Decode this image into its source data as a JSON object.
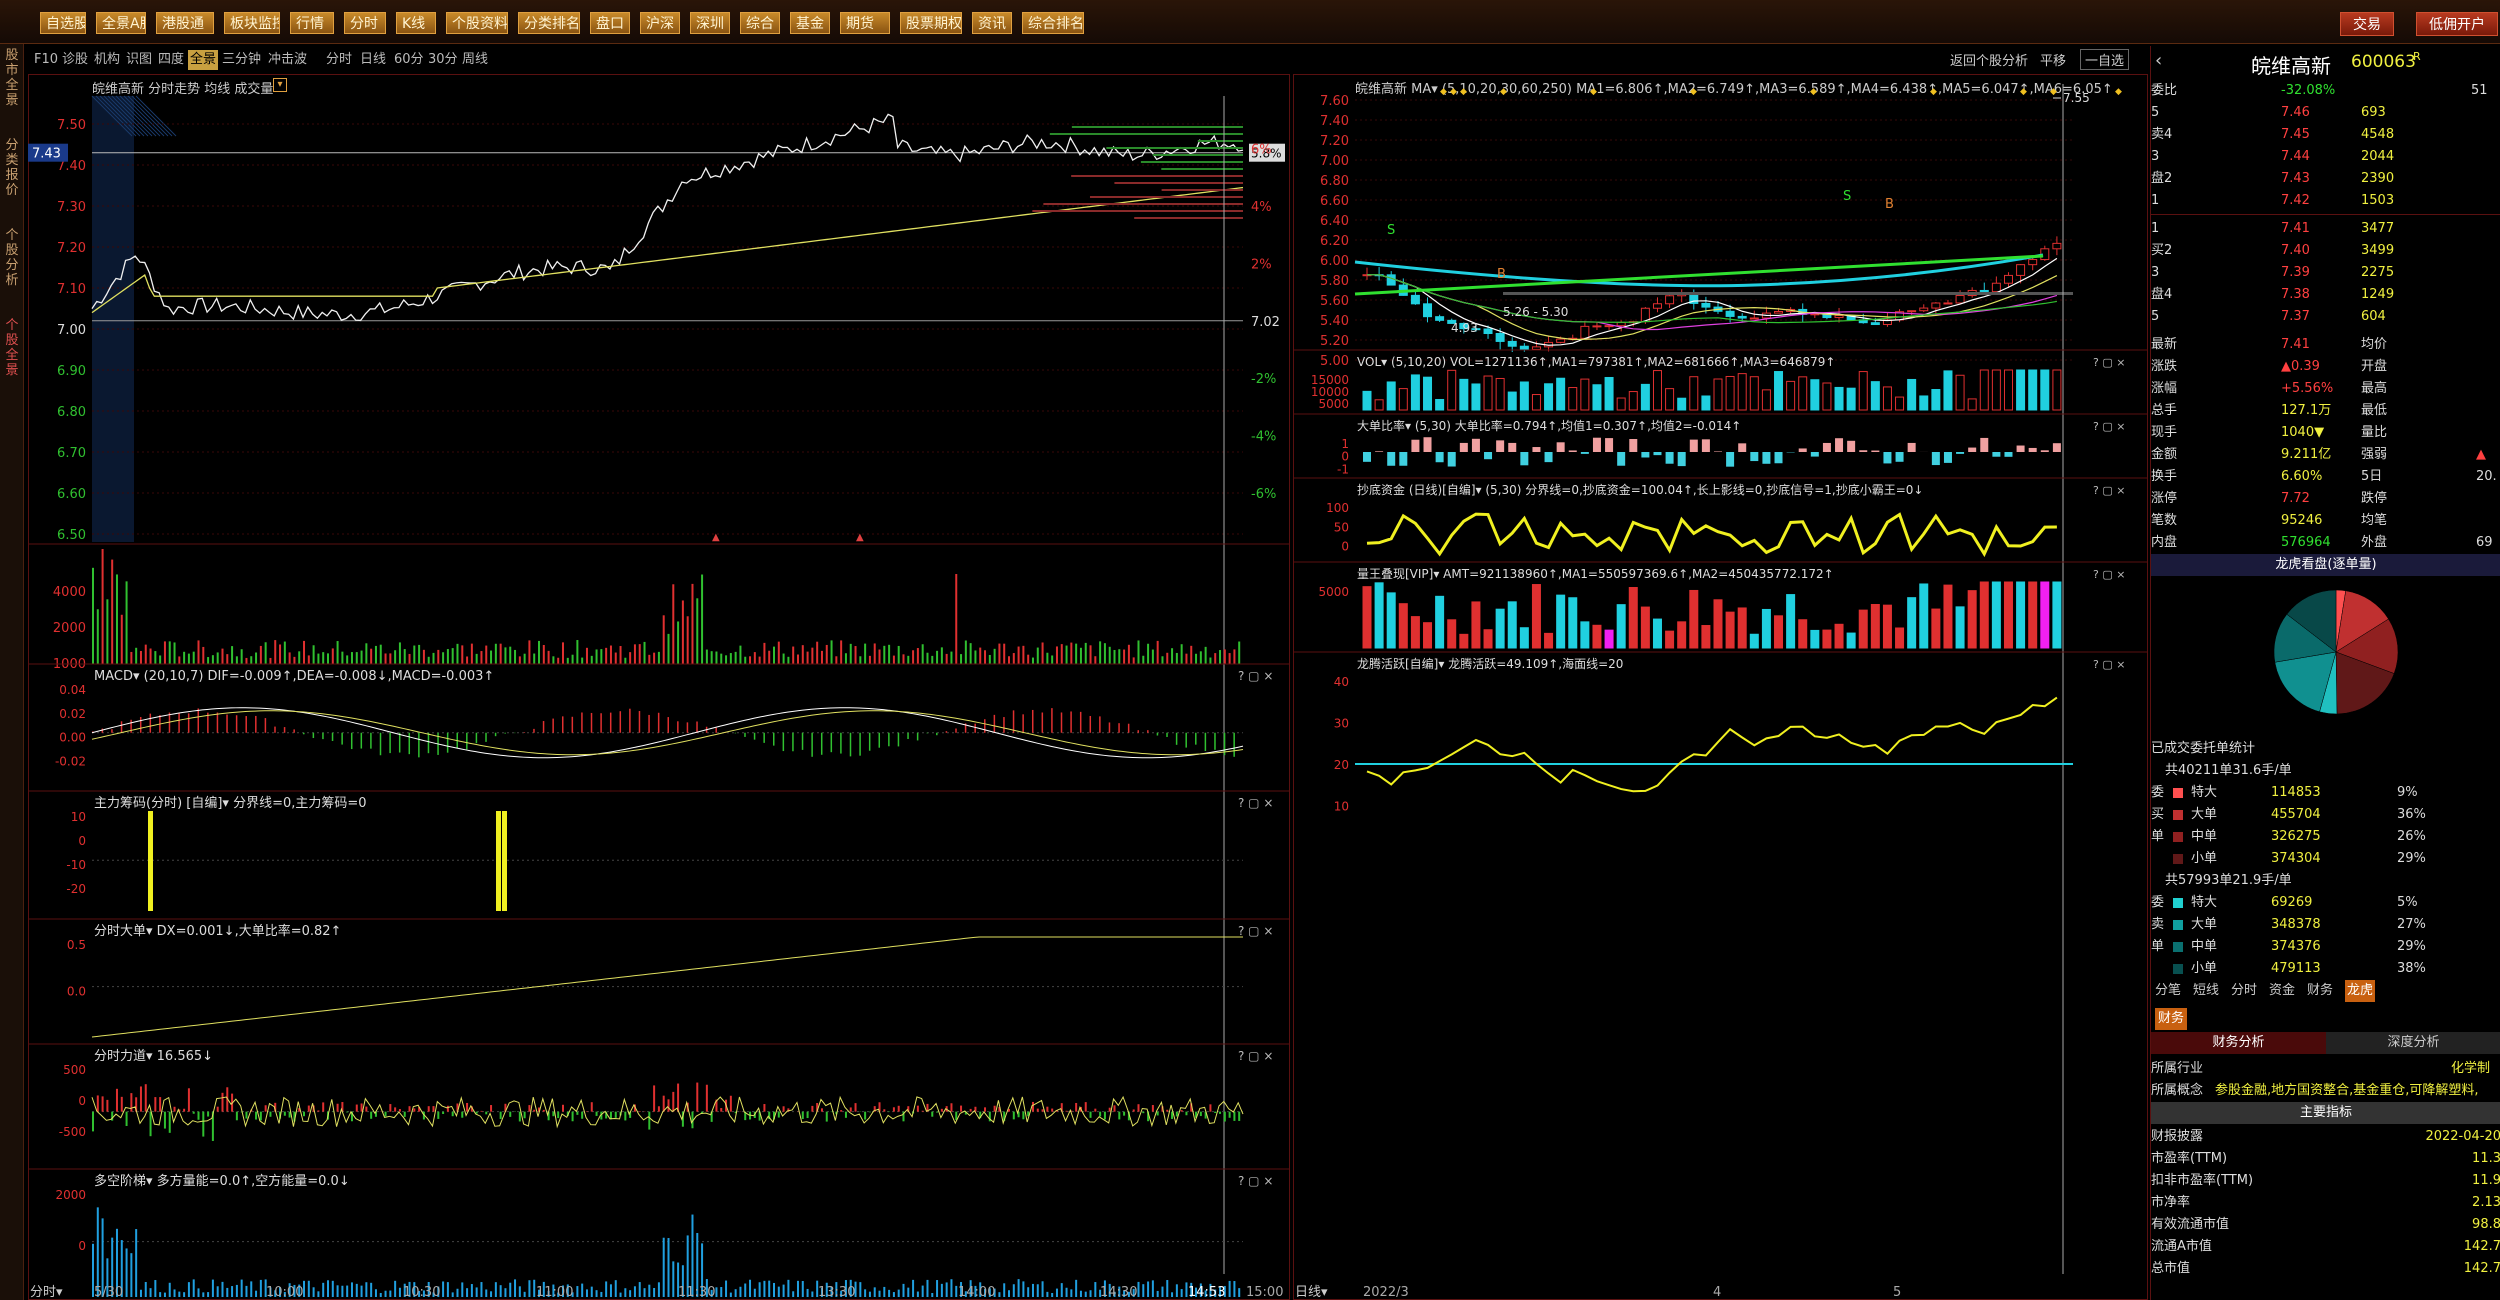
{
  "topbar": {
    "buttons": [
      "自选股",
      "全景A股",
      "港股通",
      "板块监控",
      "行情",
      "分时",
      "K线",
      "个股资料",
      "分类排名",
      "盘口",
      "沪深",
      "深圳",
      "综合",
      "基金",
      "期货",
      "股票期权",
      "资讯",
      "综合排名"
    ],
    "trade": "交易",
    "open_account": "低佣开户"
  },
  "sidestrip": {
    "tabs": [
      "股市全景",
      "分类报价",
      "个股分析",
      "个股全景"
    ]
  },
  "main_tabs": [
    "F10",
    "诊股",
    "机构",
    "识图",
    "四度",
    "全景",
    "三分钟",
    "冲击波",
    "分时",
    "日线",
    "60分",
    "30分",
    "周线"
  ],
  "main_tab_active": "全景",
  "right_tools": {
    "back": "返回个股分析",
    "flat": "平移",
    "watch": "一自选"
  },
  "intraday": {
    "title": "皖维高新  分时走势  均线 成交量",
    "price_current": "7.43",
    "pct_current": "5.8%",
    "price_labels": [
      "7.50",
      "7.40",
      "7.30",
      "7.20",
      "7.10",
      "7.00",
      "6.90",
      "6.80",
      "6.70",
      "6.60",
      "6.50"
    ],
    "pct_labels": [
      "6%",
      "4%",
      "2%",
      "7.02",
      "-2%",
      "-4%",
      "-6%"
    ],
    "time_labels": [
      "5/30",
      "10:00",
      "10:30",
      "11:00",
      "11:30",
      "13:30",
      "14:00",
      "14:30",
      "14:53",
      "15:00"
    ],
    "time_footer": "分时",
    "vol_labels": [
      "4000",
      "2000",
      "1000"
    ]
  },
  "sub_panes": [
    {
      "title": "MACD▾ (20,10,7)  DIF=-0.009↑,DEA=-0.008↓,MACD=-0.003↑",
      "yl": [
        "0.04",
        "0.02",
        "0.00",
        "-0.02"
      ]
    },
    {
      "title": "主力筹码(分时) [自编]▾  分界线=0,主力筹码=0",
      "yl": [
        "10",
        "0",
        "-10",
        "-20"
      ]
    },
    {
      "title": "分时大单▾  DX=0.001↓,大单比率=0.82↑",
      "yl": [
        "0.5",
        "0.0"
      ]
    },
    {
      "title": "分时力道▾  16.565↓",
      "yl": [
        "500",
        "0",
        "-500"
      ]
    },
    {
      "title": "多空阶梯▾  多方量能=0.0↑,空方能量=0.0↓",
      "yl": [
        "2000",
        "0"
      ]
    }
  ],
  "kline": {
    "title": "皖维高新  MA▾  (5,10,20,30,60,250)  MA1=6.806↑,MA2=6.749↑,MA3=6.589↑,MA4=6.438↑,MA5=6.047↑,MA6=6.05↑",
    "price_labels": [
      "7.60",
      "7.40",
      "7.20",
      "7.00",
      "6.80",
      "6.60",
      "6.40",
      "6.20",
      "6.00",
      "5.80",
      "5.60",
      "5.40",
      "5.20",
      "5.00"
    ],
    "high_label": "7.55",
    "low_label": "4.93",
    "range_label": "5.26 - 5.30",
    "date_labels": [
      "2022/3",
      "4",
      "5"
    ],
    "date_footer": "日线"
  },
  "kpanes": [
    {
      "title": "VOL▾  (5,10,20)  VOL=1271136↑,MA1=797381↑,MA2=681666↑,MA3=646879↑",
      "yl": [
        "15000",
        "10000",
        "5000"
      ]
    },
    {
      "title": "大单比率▾  (5,30)  大单比率=0.794↑,均值1=0.307↑,均值2=-0.014↑",
      "yl": [
        "1",
        "0",
        "-1"
      ]
    },
    {
      "title": "抄底资金 (日线)[自编]▾  (5,30)  分界线=0,抄底资金=100.04↑,长上影线=0,抄底信号=1,抄底小霸王=0↓",
      "yl": [
        "100",
        "50",
        "0"
      ]
    },
    {
      "title": "量王叠现[VIP]▾  AMT=921138960↑,MA1=550597369.6↑,MA2=450435772.172↑",
      "yl": [
        "5000"
      ]
    },
    {
      "title": "龙腾活跃[自编]▾  龙腾活跃=49.109↑,海面线=20",
      "yl": [
        "40",
        "30",
        "20",
        "10"
      ]
    }
  ],
  "quote": {
    "name": "皖维高新",
    "code": "600063",
    "weibi_label": "委比",
    "weibi_pct": "-32.08%",
    "weibi_val": "51",
    "sell": [
      {
        "lvl": "5",
        "price": "7.46",
        "vol": "693"
      },
      {
        "lvl": "4",
        "price": "7.45",
        "vol": "4548"
      },
      {
        "lvl": "3",
        "price": "7.44",
        "vol": "2044"
      },
      {
        "lvl": "2",
        "price": "7.43",
        "vol": "2390"
      },
      {
        "lvl": "1",
        "price": "7.42",
        "vol": "1503"
      }
    ],
    "buy": [
      {
        "lvl": "1",
        "price": "7.41",
        "vol": "3477"
      },
      {
        "lvl": "2",
        "price": "7.40",
        "vol": "3499"
      },
      {
        "lvl": "3",
        "price": "7.39",
        "vol": "2275"
      },
      {
        "lvl": "4",
        "price": "7.38",
        "vol": "1249"
      },
      {
        "lvl": "5",
        "price": "7.37",
        "vol": "604"
      }
    ],
    "sell_label": "卖",
    "buy_label": "买",
    "pan_label": "盘",
    "stats": [
      {
        "k": "最新",
        "v": "7.41",
        "k2": "均价",
        "v2": ""
      },
      {
        "k": "涨跌",
        "v": "▲0.39",
        "k2": "开盘",
        "v2": ""
      },
      {
        "k": "涨幅",
        "v": "+5.56%",
        "k2": "最高",
        "v2": ""
      },
      {
        "k": "总手",
        "v": "127.1万",
        "k2": "最低",
        "v2": ""
      },
      {
        "k": "现手",
        "v": "1040▼",
        "k2": "量比",
        "v2": ""
      },
      {
        "k": "金额",
        "v": "9.211亿",
        "k2": "强弱",
        "v2": "▲"
      },
      {
        "k": "换手",
        "v": "6.60%",
        "k2": "5日",
        "v2": "20."
      },
      {
        "k": "涨停",
        "v": "7.72",
        "k2": "跌停",
        "v2": ""
      },
      {
        "k": "笔数",
        "v": "95246",
        "k2": "均笔",
        "v2": ""
      },
      {
        "k": "内盘",
        "v": "576964",
        "k2": "外盘",
        "v2": "69"
      }
    ],
    "pie_title": "龙虎看盘(逐单量)",
    "order_title": "已成交委托单统计",
    "group1_header": "共40211单31.6手/单",
    "group1": [
      {
        "t": "特大",
        "v": "114853",
        "p": "9%"
      },
      {
        "t": "大单",
        "v": "455704",
        "p": "36%"
      },
      {
        "t": "中单",
        "v": "326275",
        "p": "26%"
      },
      {
        "t": "小单",
        "v": "374304",
        "p": "29%"
      }
    ],
    "group1_side": [
      "委",
      "买",
      "单"
    ],
    "group2_header": "共57993单21.9手/单",
    "group2": [
      {
        "t": "特大",
        "v": "69269",
        "p": "5%"
      },
      {
        "t": "大单",
        "v": "348378",
        "p": "27%"
      },
      {
        "t": "中单",
        "v": "374376",
        "p": "29%"
      },
      {
        "t": "小单",
        "v": "479113",
        "p": "38%"
      }
    ],
    "group2_side": [
      "委",
      "卖",
      "单"
    ],
    "bottom_tabs": [
      "分笔",
      "短线",
      "分时",
      "资金",
      "财务",
      "龙虎"
    ],
    "fin_tab": "财务",
    "fin_analysis": "财务分析",
    "depth_analysis": "深度分析",
    "industry_k": "所属行业",
    "industry_v": "化学制",
    "concept_k": "所属概念",
    "concept_v": "参股金融,地方国资整合,基金重仓,可降解塑料,",
    "main_index": "主要指标",
    "fin_rows": [
      {
        "k": "财报披露",
        "v": "2022-04-20"
      },
      {
        "k": "市盈率(TTM)",
        "v": "11.3"
      },
      {
        "k": "扣非市盈率(TTM)",
        "v": "11.9"
      },
      {
        "k": "市净率",
        "v": "2.13"
      },
      {
        "k": "有效流通市值",
        "v": "98.8"
      },
      {
        "k": "流通A市值",
        "v": "142.7"
      },
      {
        "k": "总市值",
        "v": "142.7"
      }
    ]
  }
}
